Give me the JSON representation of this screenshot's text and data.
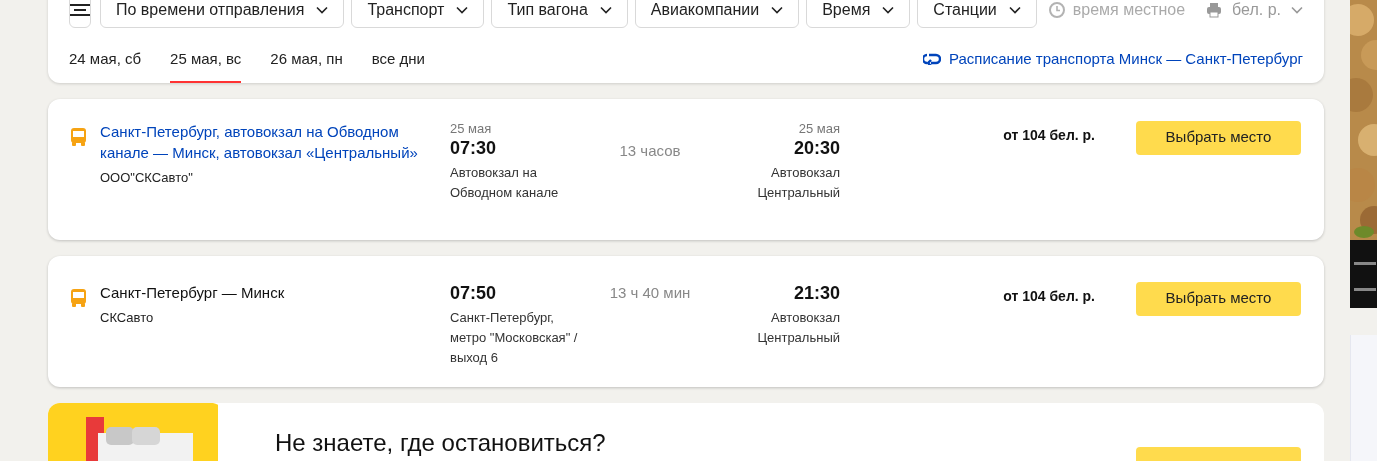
{
  "filters": [
    {
      "label": "По времени отправления"
    },
    {
      "label": "Транспорт"
    },
    {
      "label": "Тип вагона"
    },
    {
      "label": "Авиакомпании"
    },
    {
      "label": "Время"
    },
    {
      "label": "Станции"
    }
  ],
  "local_time_note": "время местное",
  "currency": "бел. р.",
  "date_tabs": [
    {
      "label": "24 мая, сб",
      "selected": false
    },
    {
      "label": "25 мая, вс",
      "selected": true
    },
    {
      "label": "26 мая, пн",
      "selected": false
    },
    {
      "label": "все дни",
      "selected": false
    }
  ],
  "schedule_link": "Расписание транспорта Минск — Санкт-Петербург",
  "trips": [
    {
      "route": "Санкт-Петербург, автовокзал на Обводном канале — Минск, автовокзал «Центральный»",
      "route_linked": true,
      "carrier": "ООО\"СКСавто\"",
      "departure": {
        "date": "25 мая",
        "time": "07:30",
        "station": "Автовокзал на Обводном канале"
      },
      "duration": "13 часов",
      "arrival": {
        "date": "25 мая",
        "time": "20:30",
        "station": "Автовокзал Центральный"
      },
      "price": "от 104 бел. р.",
      "button": "Выбрать место"
    },
    {
      "route": "Санкт-Петербург — Минск",
      "route_linked": false,
      "carrier": "СКСавто",
      "departure": {
        "time": "07:50",
        "station": "Санкт-Петербург, метро \"Московская\" / выход 6"
      },
      "duration": "13 ч 40 мин",
      "arrival": {
        "time": "21:30",
        "station": "Автовокзал Центральный"
      },
      "price": "от 104 бел. р.",
      "button": "Выбрать место"
    }
  ],
  "promo": {
    "title": "Не знаете, где остановиться?"
  }
}
